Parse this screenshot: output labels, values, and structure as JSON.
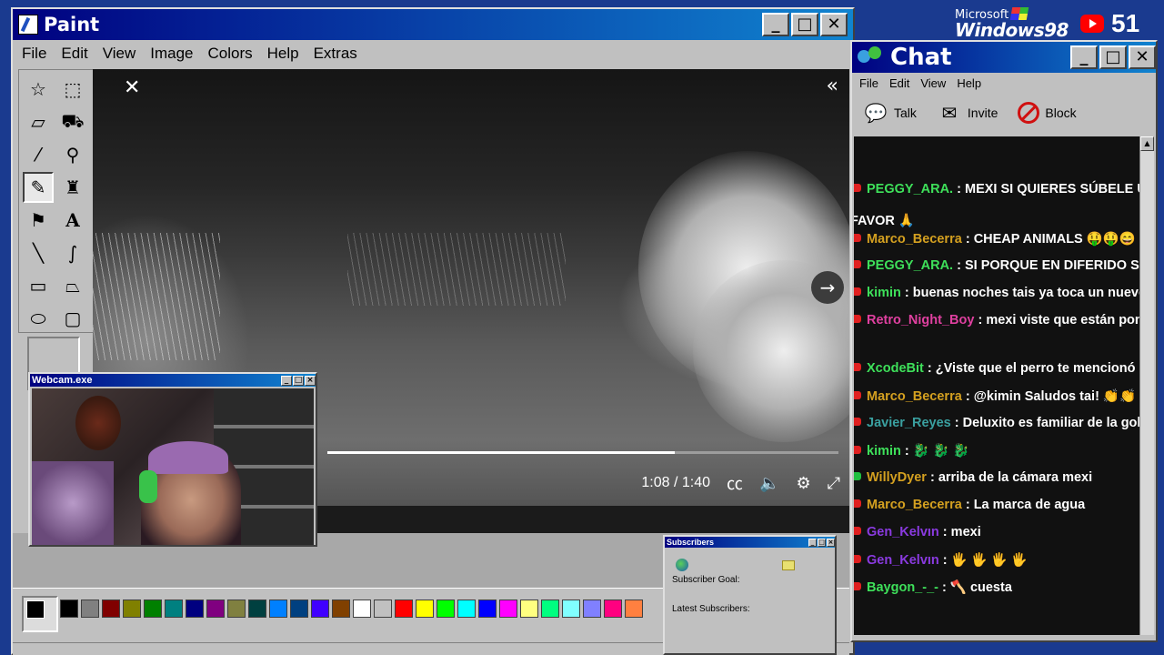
{
  "paint": {
    "title": "Paint",
    "menu": [
      "File",
      "Edit",
      "View",
      "Image",
      "Colors",
      "Help",
      "Extras"
    ],
    "tools": [
      "free-select",
      "rect-select",
      "eraser",
      "fill",
      "color-picker",
      "magnifier",
      "pencil",
      "brush",
      "airbrush",
      "text",
      "line",
      "curve",
      "rectangle",
      "polygon",
      "ellipse",
      "rounded-rect"
    ],
    "palette": [
      "#000000",
      "#808080",
      "#800000",
      "#808000",
      "#008000",
      "#008080",
      "#000080",
      "#800080",
      "#808040",
      "#004040",
      "#0080ff",
      "#004080",
      "#4000ff",
      "#804000",
      "#ffffff",
      "#c0c0c0",
      "#ff0000",
      "#ffff00",
      "#00ff00",
      "#00ffff",
      "#0000ff",
      "#ff00ff",
      "#ffff80",
      "#00ff80",
      "#80ffff",
      "#8080ff",
      "#ff0080",
      "#ff8040"
    ]
  },
  "video": {
    "time": "1:08 / 1:40",
    "progress": 0.68
  },
  "webcam": {
    "title": "Webcam.exe"
  },
  "subscribers_window": {
    "title": "Subscribers",
    "goal_label": "Subscriber Goal:",
    "latest_label": "Latest Subscribers:"
  },
  "brand": {
    "microsoft": "Microsoft",
    "windows": "Windows98",
    "sub_count": "51"
  },
  "chat": {
    "title": "Chat",
    "menu": [
      "File",
      "Edit",
      "View",
      "Help"
    ],
    "tools": [
      "Talk",
      "Invite",
      "Block"
    ],
    "messages": [
      {
        "user": "PEGGY_ARA.",
        "color": "#3ee05a",
        "text": "MEXI SI QUIERES SÚBELE UN",
        "badge": "red"
      },
      {
        "user": "Marco_Becerra",
        "color": "#d4a020",
        "text": "CHEAP ANIMALS 🤑🤑😄",
        "badge": "red"
      },
      {
        "user": "PEGGY_ARA.",
        "color": "#3ee05a",
        "text": "SI PORQUE EN DIFERIDO SE E",
        "badge": "red"
      },
      {
        "user": "kimin",
        "color": "#3ee05a",
        "text": "buenas noches tais ya toca un nuevo n",
        "badge": "red"
      },
      {
        "user": "Retro_Night_Boy",
        "color": "#e040a0",
        "text": "mexi viste que están ponie",
        "badge": "red"
      },
      {
        "user": "XcodeBit",
        "color": "#3ee05a",
        "text": "¿Viste que el perro te mencionó ho",
        "badge": "red"
      },
      {
        "user": "Marco_Becerra",
        "color": "#d4a020",
        "text": "@kimin Saludos tai! 👏👏",
        "badge": "red"
      },
      {
        "user": "Javier_Reyes",
        "color": "#3aa0a0",
        "text": "Deluxito es familiar de la golli",
        "badge": "red"
      },
      {
        "user": "kimin",
        "color": "#3ee05a",
        "text": "🐉 🐉 🐉",
        "badge": "red"
      },
      {
        "user": "WillyDyer",
        "color": "#d4a020",
        "text": "arriba de la cámara mexi",
        "badge": "green"
      },
      {
        "user": "Marco_Becerra",
        "color": "#d4a020",
        "text": "La marca de agua",
        "badge": "red"
      },
      {
        "user": "Gen_Kelvın",
        "color": "#8a3ae0",
        "text": "mexi",
        "badge": "red"
      },
      {
        "user": "Gen_Kelvın",
        "color": "#8a3ae0",
        "text": "🖐 🖐 🖐 🖐",
        "badge": "red"
      },
      {
        "user": "Baygon_-_-",
        "color": "#3ee05a",
        "text": "🪓 cuesta",
        "badge": "red"
      }
    ],
    "continuation": "FAVOR 🙏"
  }
}
